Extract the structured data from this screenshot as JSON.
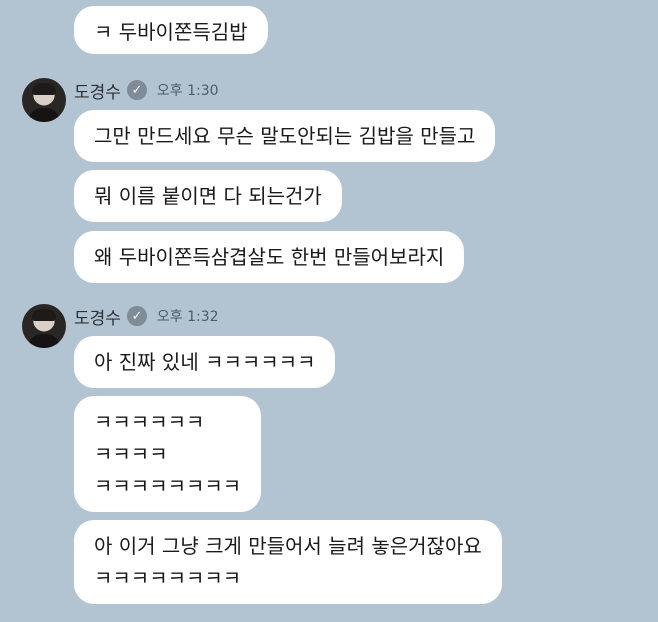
{
  "messages_top": {
    "bubble1": "ㅋ 두바이쫀득김밥"
  },
  "group1": {
    "sender_name": "도경수",
    "time": "오후 1:30",
    "bubbles": [
      "그만 만드세요 무슨 말도안되는 김밥을 만들고",
      "뭐 이름 붙이면 다 되는건가",
      "왜 두바이쫀득삼겹살도 한번 만들어보라지"
    ]
  },
  "group2": {
    "sender_name": "도경수",
    "time": "오후 1:32",
    "bubble1": "아 진짜 있네 ㅋㅋㅋㅋㅋㅋ",
    "bubble2_lines": [
      "ㅋㅋㅋㅋㅋㅋ",
      "ㅋㅋㅋㅋ",
      "ㅋㅋㅋㅋㅋㅋㅋㅋ"
    ],
    "bubble3_lines": [
      "아 이거 그냥 크게 만들어서 늘려 놓은거잖아요",
      "ㅋㅋㅋㅋㅋㅋㅋㅋ"
    ]
  },
  "icons": {
    "verified": "verified-check-icon",
    "avatar": "profile-avatar"
  },
  "colors": {
    "background": "#b2c3d2",
    "bubble": "#ffffff",
    "badge": "#7f8b97"
  }
}
